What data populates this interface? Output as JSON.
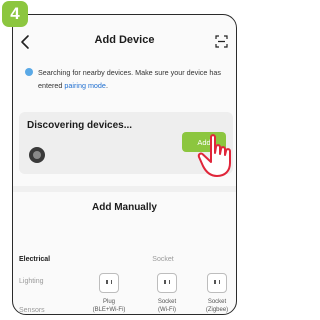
{
  "step": "4",
  "header": {
    "title": "Add Device"
  },
  "notice": {
    "text": "Searching for nearby devices. Make sure your device has entered ",
    "link": "pairing mode",
    "suffix": "."
  },
  "discovery": {
    "title": "Discovering devices...",
    "add_label": "Add"
  },
  "manual": {
    "title": "Add Manually"
  },
  "categories": [
    "Electrical",
    "Lighting",
    "Sensors"
  ],
  "group": {
    "label": "Socket"
  },
  "devices": [
    {
      "line1": "Plug",
      "line2": "(BLE+Wi-Fi)"
    },
    {
      "line1": "Socket",
      "line2": "(Wi-Fi)"
    },
    {
      "line1": "Socket",
      "line2": "(Zigbee)"
    }
  ],
  "colors": {
    "accent": "#8cc63f",
    "link": "#1f6fd0",
    "notice_dot": "#5aa9e6"
  }
}
